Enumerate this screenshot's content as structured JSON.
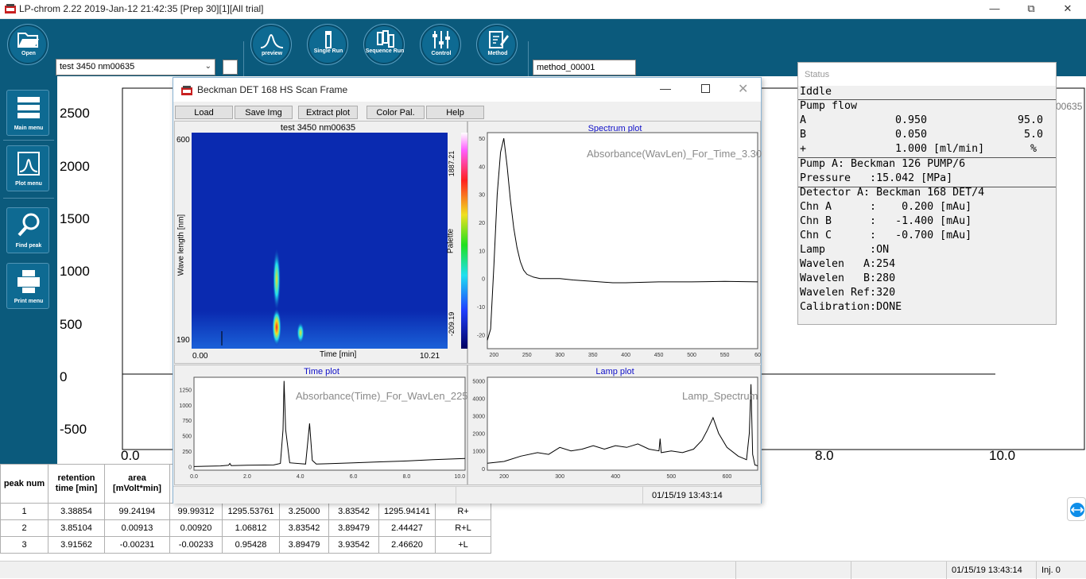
{
  "window": {
    "title": "LP-chrom 2.22 2019-Jan-12 21:42:35 [Prep 30][1][All trial]"
  },
  "toolbar": {
    "open_label": "Open",
    "file_value": "test 3450 nm00635",
    "preview_label": "preview",
    "single_run_label": "Single Run",
    "sequence_run_label": "Sequence Run",
    "control_label": "Control",
    "method_label": "Method",
    "method_value": "method_00001"
  },
  "sidebar": {
    "main_menu": "Main menu",
    "plot_menu": "Plot menu",
    "find_peak": "Find peak",
    "print_menu": "Print menu"
  },
  "background_chart": {
    "clipped_label": "00635",
    "y_ticks": [
      "2500",
      "2000",
      "1500",
      "1000",
      "500",
      "0",
      "-500"
    ],
    "x_ticks": [
      "0.0",
      "8.0",
      "10.0"
    ],
    "chart_data": {
      "type": "line",
      "x_visible_range": [
        0,
        10.0
      ],
      "y_range": [
        -500,
        2500
      ],
      "series": [
        {
          "x": [
            0,
            10.0
          ],
          "y": [
            0,
            0
          ]
        }
      ]
    }
  },
  "scan_window": {
    "title": "Beckman DET 168 HS Scan Frame",
    "buttons": [
      "Load",
      "Save Img",
      "Extract plot",
      "Color Pal.",
      "Help"
    ],
    "heatmap": {
      "title": "test 3450 nm00635",
      "y_label": "Wave length [nm]",
      "x_label": "Time [min]",
      "y_max": "600",
      "y_min": "190",
      "x_min": "0.00",
      "x_max": "10.21",
      "palette_label": "Palette",
      "palette_max": "1887.21",
      "palette_min": "-209.19",
      "colors": {
        "background": "#0a2ab0",
        "hot": "#ff2020",
        "warm": "#f0e020",
        "cool": "#20e0f0"
      }
    },
    "spectrum_plot": {
      "title": "Spectrum plot",
      "subtitle": "Absorbance(WavLen)_For_Time_3.30",
      "chart_data": {
        "type": "line",
        "x_ticks": [
          "200",
          "250",
          "300",
          "350",
          "400",
          "450",
          "500",
          "550",
          "60"
        ],
        "y_ticks": [
          "50",
          "40",
          "30",
          "20",
          "10",
          "0",
          "-10",
          "-20"
        ],
        "xlim": [
          190,
          600
        ],
        "ylim": [
          -25,
          52
        ],
        "x": [
          190,
          195,
          200,
          205,
          210,
          215,
          220,
          225,
          230,
          235,
          240,
          245,
          250,
          260,
          270,
          280,
          300,
          320,
          350,
          380,
          400,
          450,
          500,
          550,
          600
        ],
        "y": [
          -22,
          -18,
          5,
          30,
          45,
          50,
          40,
          28,
          18,
          11,
          6,
          3,
          1.5,
          0.5,
          0,
          0,
          0,
          -0.5,
          -1,
          -1.5,
          -1.5,
          -1.2,
          -1.2,
          -1.0,
          -1.2
        ]
      }
    },
    "time_plot": {
      "title": "Time plot",
      "subtitle": "Absorbance(Time)_For_WavLen_225",
      "chart_data": {
        "type": "line",
        "x_ticks": [
          "0.0",
          "2.0",
          "4.0",
          "6.0",
          "8.0",
          "10.0"
        ],
        "y_ticks": [
          "1250",
          "1000",
          "750",
          "500",
          "250",
          "0"
        ],
        "xlim": [
          0,
          10.2
        ],
        "ylim": [
          -60,
          1450
        ],
        "x": [
          0,
          1.0,
          1.3,
          1.35,
          1.4,
          2.0,
          3.0,
          3.25,
          3.35,
          3.39,
          3.45,
          3.6,
          4.2,
          4.35,
          4.45,
          4.6,
          5,
          6,
          7,
          8,
          9,
          10.2
        ],
        "y": [
          0,
          10,
          20,
          50,
          15,
          20,
          25,
          50,
          600,
          1390,
          600,
          60,
          40,
          700,
          100,
          40,
          45,
          60,
          75,
          90,
          110,
          130
        ]
      }
    },
    "lamp_plot": {
      "title": "Lamp plot",
      "subtitle": "Lamp_Spectrum",
      "chart_data": {
        "type": "line",
        "x_ticks": [
          "200",
          "300",
          "400",
          "500",
          "600"
        ],
        "y_ticks": [
          "5000",
          "4000",
          "3000",
          "2000",
          "1000",
          "0"
        ],
        "xlim": [
          170,
          655
        ],
        "ylim": [
          -100,
          5200
        ],
        "x": [
          170,
          200,
          230,
          260,
          280,
          300,
          320,
          340,
          360,
          380,
          400,
          420,
          440,
          460,
          478,
          480,
          482,
          500,
          520,
          540,
          555,
          565,
          575,
          585,
          600,
          620,
          635,
          640,
          643,
          646,
          650,
          655
        ],
        "y": [
          300,
          400,
          700,
          900,
          800,
          1200,
          1000,
          1100,
          1300,
          1100,
          1300,
          1200,
          1400,
          1100,
          1000,
          1700,
          900,
          1000,
          900,
          1100,
          1600,
          2200,
          2900,
          2000,
          1200,
          700,
          500,
          2000,
          4800,
          800,
          200,
          150
        ]
      }
    },
    "status_timestamp": "01/15/19 13:43:14"
  },
  "status_window": {
    "title": "Status",
    "state": "Iddle",
    "pump_flow": "Pump flow",
    "pump_rows": [
      {
        "name": "A",
        "flow": "0.950",
        "pct": "95.0"
      },
      {
        "name": "B",
        "flow": "0.050",
        "pct": "5.0"
      },
      {
        "name": "+",
        "flow": "1.000 [ml/min]",
        "pct": "%"
      }
    ],
    "pump_model": "Pump A: Beckman 126 PUMP/6",
    "pressure": "Pressure   :15.042 [MPa]",
    "detector_rows": [
      "Detector A: Beckman 168 DET/4",
      "Chn A      :    0.200 [mAu]",
      "Chn B      :   -1.400 [mAu]",
      "Chn C      :   -0.700 [mAu]",
      "Lamp       :ON",
      "Wavelen   A:254",
      "Wavelen   B:280",
      "Wavelen Ref:320",
      "Calibration:DONE"
    ]
  },
  "peak_table": {
    "headers": [
      "peak num",
      "retention time [min]",
      "area [mVolt*min]"
    ],
    "rows": [
      [
        "1",
        "3.38854",
        "99.24194",
        "99.99312",
        "1295.53761",
        "3.25000",
        "3.83542",
        "1295.94141",
        "R+"
      ],
      [
        "2",
        "3.85104",
        "0.00913",
        "0.00920",
        "1.06812",
        "3.83542",
        "3.89479",
        "2.44427",
        "R+L"
      ],
      [
        "3",
        "3.91562",
        "-0.00231",
        "-0.00233",
        "0.95428",
        "3.89479",
        "3.93542",
        "2.46620",
        "+L"
      ]
    ]
  },
  "statusbar": {
    "timestamp": "01/15/19 13:43:14",
    "injection": "Inj. 0"
  }
}
